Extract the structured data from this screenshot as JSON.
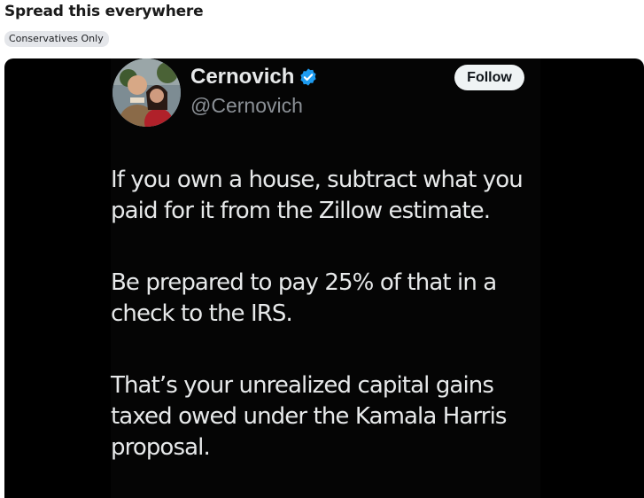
{
  "post": {
    "title": "Spread this everywhere",
    "group_chip": "Conservatives Only"
  },
  "tweet": {
    "display_name": "Cernovich",
    "handle": "@Cernovich",
    "follow_label": "Follow",
    "verified_color": "#1d9bf0",
    "paragraphs": [
      [
        "If you own a house, subtract what you",
        "paid for it from the Zillow estimate."
      ],
      [
        "Be prepared to pay 25% of that in a",
        "check to the IRS."
      ],
      [
        "That’s your unrealized capital gains",
        "taxed owed under the Kamala Harris",
        "proposal."
      ]
    ]
  }
}
